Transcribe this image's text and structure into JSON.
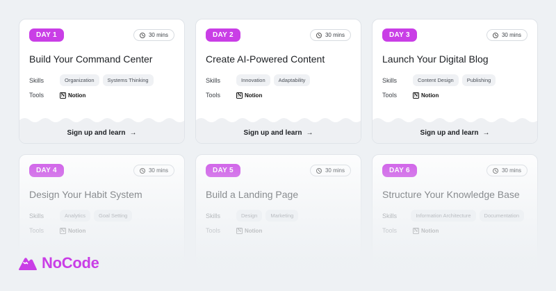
{
  "cards": [
    {
      "day": "DAY 1",
      "duration": "30 mins",
      "title": "Build Your Command Center",
      "skills_label": "Skills",
      "skills": [
        "Organization",
        "Systems Thinking"
      ],
      "tools_label": "Tools",
      "tool": "Notion",
      "cta": "Sign up and learn",
      "cta_arrow": "→"
    },
    {
      "day": "DAY 2",
      "duration": "30 mins",
      "title": "Create AI-Powered Content",
      "skills_label": "Skills",
      "skills": [
        "Innovation",
        "Adaptability"
      ],
      "tools_label": "Tools",
      "tool": "Notion",
      "cta": "Sign up and learn",
      "cta_arrow": "→"
    },
    {
      "day": "DAY 3",
      "duration": "30 mins",
      "title": "Launch Your Digital Blog",
      "skills_label": "Skills",
      "skills": [
        "Content Design",
        "Publishing"
      ],
      "tools_label": "Tools",
      "tool": "Notion",
      "cta": "Sign up and learn",
      "cta_arrow": "→"
    },
    {
      "day": "DAY 4",
      "duration": "30 mins",
      "title": "Design Your Habit System",
      "skills_label": "Skills",
      "skills": [
        "Analytics",
        "Goal Setting"
      ],
      "tools_label": "Tools",
      "tool": "Notion"
    },
    {
      "day": "DAY 5",
      "duration": "30 mins",
      "title": "Build a Landing Page",
      "skills_label": "Skills",
      "skills": [
        "Design",
        "Marketing"
      ],
      "tools_label": "Tools",
      "tool": "Notion"
    },
    {
      "day": "DAY 6",
      "duration": "30 mins",
      "title": "Structure Your Knowledge Base",
      "skills_label": "Skills",
      "skills": [
        "Information Architecture",
        "Documentation"
      ],
      "tools_label": "Tools",
      "tool": "Notion"
    }
  ],
  "brand": {
    "name": "NoCode",
    "accent_color": "#c93ee6",
    "logo_icon": "mountain-logo-icon",
    "notion_icon": "notion-icon",
    "clock_icon": "clock-icon"
  }
}
